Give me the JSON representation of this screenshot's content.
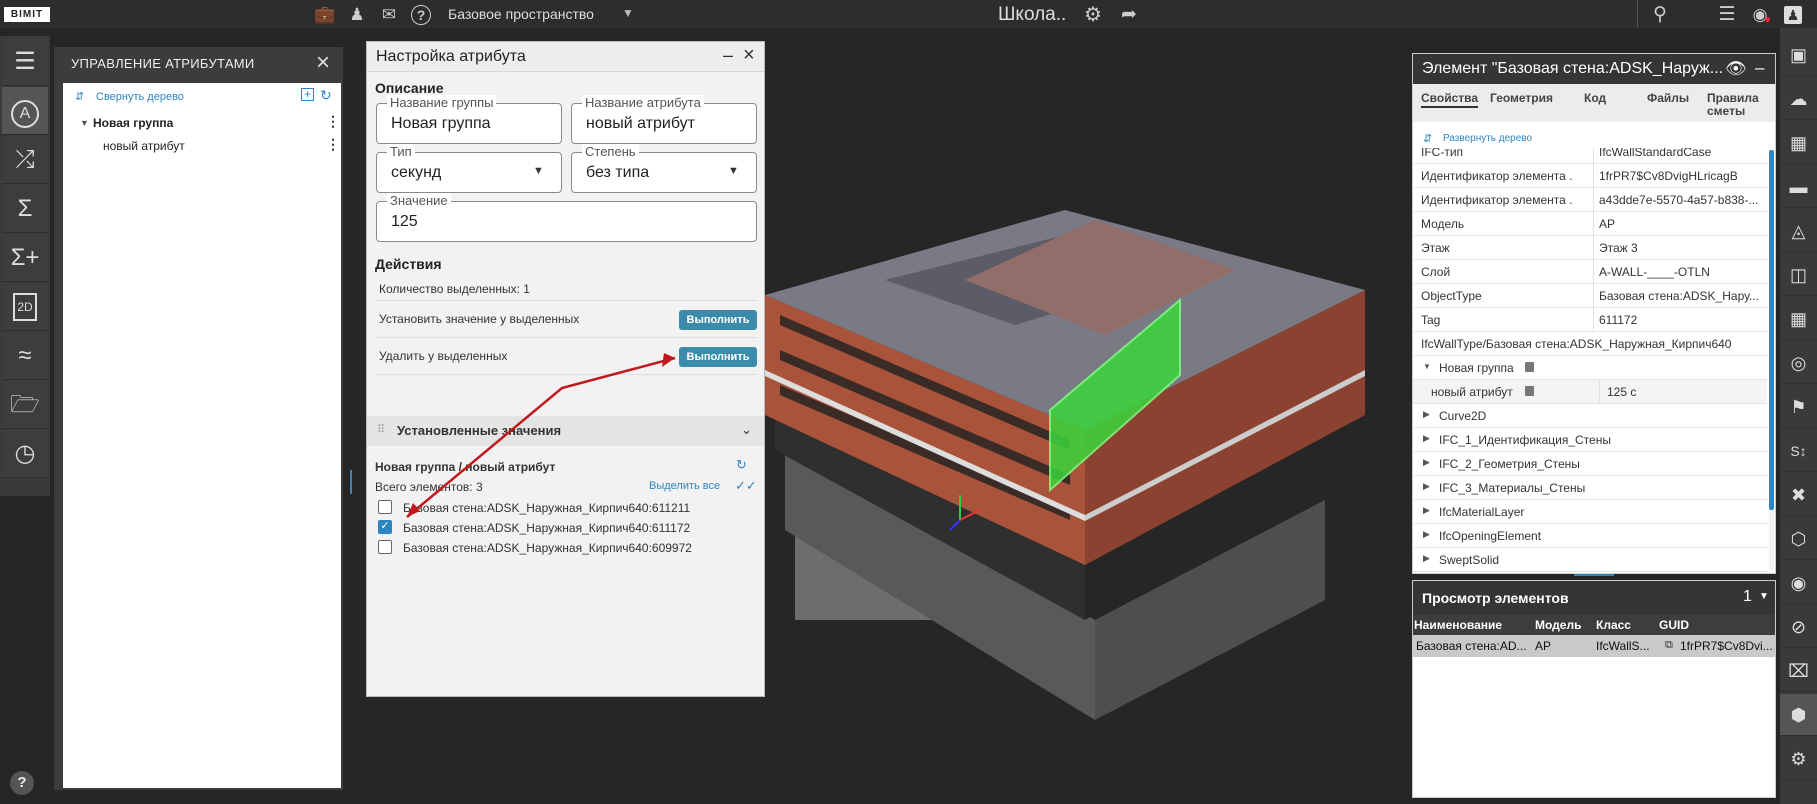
{
  "topbar": {
    "logo": "BIMIT",
    "workspace": "Базовое пространство",
    "project_title": "Школа..",
    "icons": [
      "briefcase-icon",
      "users-icon",
      "chat-icon",
      "help-icon",
      "settings-icon",
      "share-icon",
      "search-icon",
      "list-icon",
      "user-status-icon",
      "account-icon"
    ]
  },
  "left_rail": {
    "items": [
      "tree-icon",
      "attribute-icon",
      "shuffle-icon",
      "sigma-icon",
      "sigma-plus-icon",
      "plan-2d-icon",
      "chart-icon",
      "folder-open-icon",
      "gauge-icon"
    ],
    "selected_index": 1,
    "help": "?"
  },
  "attr_panel": {
    "title": "УПРАВЛЕНИЕ АТРИБУТАМИ",
    "collapse_label": "Свернуть дерево",
    "group_name": "Новая группа",
    "attribute_name": "новый атрибут"
  },
  "dialog": {
    "title": "Настройка атрибута",
    "description_header": "Описание",
    "group_name_label": "Название группы",
    "group_name_value": "Новая группа",
    "attr_name_label": "Название атрибута",
    "attr_name_value": "новый атрибут",
    "type_label": "Тип",
    "type_value": "секунд",
    "degree_label": "Степень",
    "degree_value": "без типа",
    "value_label": "Значение",
    "value_value": "125",
    "actions_header": "Действия",
    "selected_count": "Количество выделенных: 1",
    "set_value_text": "Установить значение у выделенных",
    "delete_text": "Удалить у выделенных",
    "run_label": "Выполнить",
    "installed_header": "Установленные значения",
    "path": "Новая группа / новый атрибут",
    "total": "Всего элементов: 3",
    "select_all": "Выделить все",
    "elements": [
      {
        "name": "Базовая стена:ADSK_Наружная_Кирпич640:611211",
        "checked": false
      },
      {
        "name": "Базовая стена:ADSK_Наружная_Кирпич640:611172",
        "checked": true
      },
      {
        "name": "Базовая стена:ADSK_Наружная_Кирпич640:609972",
        "checked": false
      }
    ]
  },
  "element_panel": {
    "title": "Элемент \"Базовая стена:ADSK_Наруж...",
    "tabs": [
      "Свойства",
      "Геометрия",
      "Код",
      "Файлы",
      "Правила сметы"
    ],
    "expand_label": "Развернуть дерево",
    "properties": [
      {
        "key": "IFC-тип",
        "value": "IfcWallStandardCase"
      },
      {
        "key": "Идентификатор элемента ...",
        "value": "1frPR7$Cv8DvigHLricagB"
      },
      {
        "key": "Идентификатор элемента ...",
        "value": "a43dde7e-5570-4a57-b838-..."
      },
      {
        "key": "Модель",
        "value": "АР"
      },
      {
        "key": "Этаж",
        "value": "Этаж 3"
      },
      {
        "key": "Слой",
        "value": "A-WALL-____-OTLN"
      },
      {
        "key": "ObjectType",
        "value": "Базовая стена:ADSK_Нару..."
      },
      {
        "key": "Tag",
        "value": "611172"
      }
    ],
    "type_row": "IfcWallType/Базовая стена:ADSK_Наружная_Кирпич640",
    "group_row": "Новая группа",
    "attr_row_key": "новый атрибут",
    "attr_row_value": "125 с",
    "collapsed_groups": [
      "Curve2D",
      "IFC_1_Идентификация_Стены",
      "IFC_2_Геометрия_Стены",
      "IFC_3_Материалы_Стены",
      "IfcMaterialLayer",
      "IfcOpeningElement",
      "SweptSolid"
    ]
  },
  "view_panel": {
    "title": "Просмотр элементов",
    "count": "1",
    "columns": [
      "Наименование",
      "Модель",
      "Класс",
      "GUID"
    ],
    "row": [
      "Базовая стена:AD...",
      "АР",
      "IfcWallS...",
      "1frPR7$Cv8Dvi..."
    ]
  },
  "right_rail": {
    "items": [
      "fit-icon",
      "cloud-icon",
      "section-box-icon",
      "ruler-icon",
      "plane-icon",
      "cube-split-icon",
      "grid-icon",
      "target-icon",
      "flag-icon",
      "snap-icon",
      "axes-icon",
      "box-icon",
      "eye-icon",
      "eye-off-icon",
      "hide-icon",
      "cube-solid-icon",
      "settings-cube-icon"
    ]
  },
  "colors": {
    "accent": "#3c8bab",
    "link": "#2e86c1",
    "highlight": "#39d63a",
    "brick": "#a9533a"
  }
}
